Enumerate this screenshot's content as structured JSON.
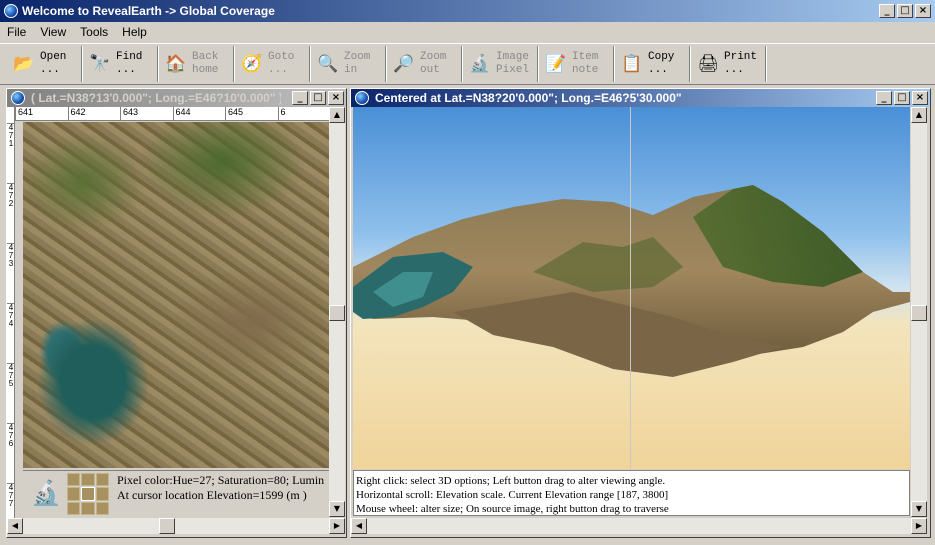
{
  "app": {
    "title": "Welcome to RevealEarth -> Global Coverage"
  },
  "menu": [
    "File",
    "View",
    "Tools",
    "Help"
  ],
  "toolbar": [
    {
      "label": "Open\n...",
      "icon": "open-icon",
      "glyph": "📂",
      "enabled": true
    },
    {
      "label": "Find\n...",
      "icon": "binoculars-icon",
      "glyph": "🔭",
      "enabled": true
    },
    {
      "label": "Back\nhome",
      "icon": "home-icon",
      "glyph": "🏠",
      "enabled": false
    },
    {
      "label": "Goto\n...",
      "icon": "compass-icon",
      "glyph": "🧭",
      "enabled": false
    },
    {
      "label": "Zoom\nin",
      "icon": "zoom-in-icon",
      "glyph": "🔍",
      "enabled": false
    },
    {
      "label": "Zoom\nout",
      "icon": "zoom-out-icon",
      "glyph": "🔎",
      "enabled": false
    },
    {
      "label": "Image\nPixel",
      "icon": "microscope-icon",
      "glyph": "🔬",
      "enabled": false
    },
    {
      "label": "Item\nnote",
      "icon": "note-icon",
      "glyph": "📝",
      "enabled": false
    },
    {
      "label": "Copy\n...",
      "icon": "copy-icon",
      "glyph": "📋",
      "enabled": true
    },
    {
      "label": "Print\n...",
      "icon": "print-icon",
      "glyph": "🖨",
      "enabled": true
    }
  ],
  "left_window": {
    "title": "( Lat.=N38?13'0.000\"; Long.=E46?10'0.000\" )",
    "ruler_top": [
      "641",
      "642",
      "643",
      "644",
      "645",
      "6"
    ],
    "ruler_left": [
      "4\n7\n1",
      "4\n7\n2",
      "4\n7\n3",
      "4\n7\n4",
      "4\n7\n5",
      "4\n7\n6",
      "4\n7\n7"
    ],
    "info_line1": "Pixel color:Hue=27;  Saturation=80;  Lumin",
    "info_line2": "At cursor location Elevation=1599 (m )"
  },
  "right_window": {
    "title": "Centered at Lat.=N38?20'0.000\"; Long.=E46?5'30.000\"",
    "status": [
      "Right click: select 3D options; Left button drag to alter viewing angle.",
      "Horizontal scroll: Elevation scale. Current Elevation range [187, 3800]",
      "Mouse wheel: alter size; On source image, right button drag to traverse"
    ]
  }
}
